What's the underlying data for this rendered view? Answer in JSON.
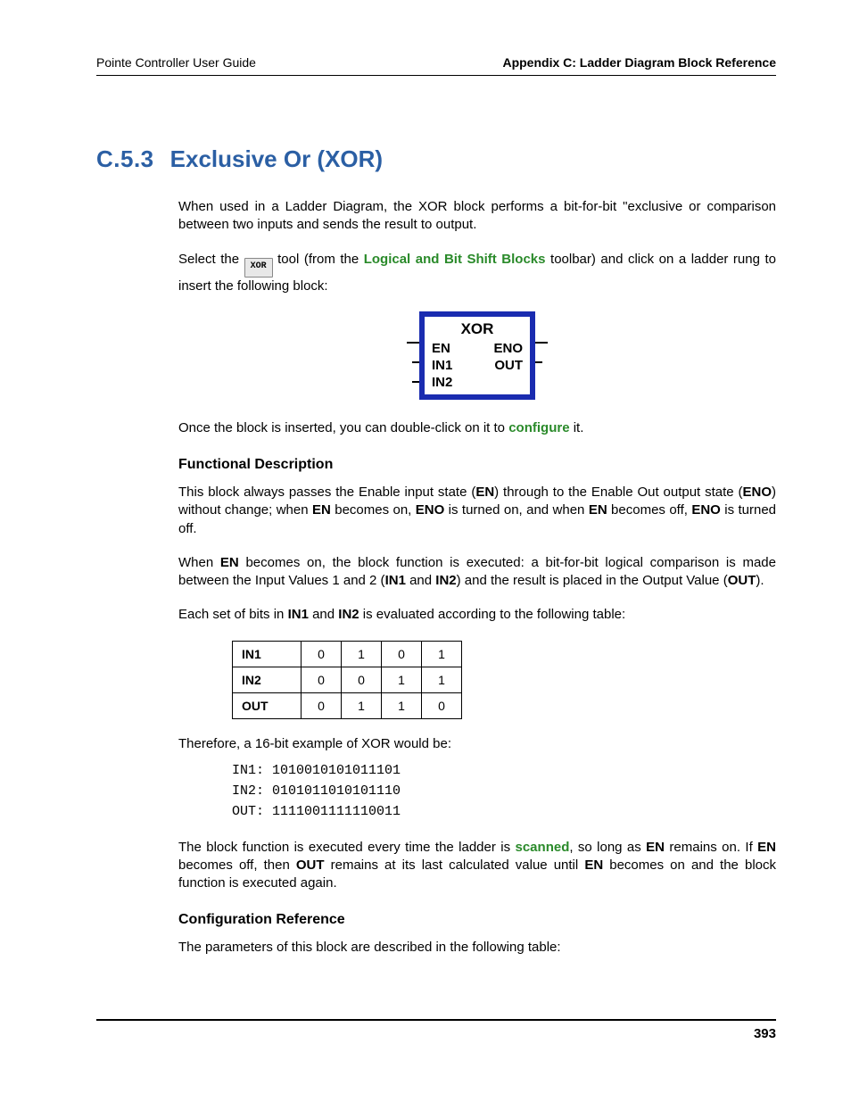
{
  "header": {
    "left": "Pointe Controller User Guide",
    "right": "Appendix C: Ladder Diagram Block Reference"
  },
  "section": {
    "number": "C.5.3",
    "title": "Exclusive Or (XOR)"
  },
  "intro_para": "When used in a Ladder Diagram, the XOR block performs a bit-for-bit \"exclusive or comparison between two inputs and sends the result to output.",
  "select_para": {
    "pre": "Select the ",
    "btn": "XOR",
    "mid": " tool (from the ",
    "link": "Logical and Bit Shift Blocks",
    "post": " toolbar) and click on a ladder rung to insert the following block:"
  },
  "block": {
    "title": "XOR",
    "rows": [
      [
        "EN",
        "ENO"
      ],
      [
        "IN1",
        "OUT"
      ],
      [
        "IN2",
        ""
      ]
    ]
  },
  "after_block": {
    "pre": "Once the block is inserted, you can double-click on it to ",
    "link": "configure",
    "post": " it."
  },
  "subhead_functional": "Functional Description",
  "func_para1": {
    "t1": "This block always passes the Enable input state (",
    "b1": "EN",
    "t2": ") through to the Enable Out output state (",
    "b2": "ENO",
    "t3": ") without change; when ",
    "b3": "EN",
    "t4": " becomes on, ",
    "b4": "ENO",
    "t5": " is turned on, and when ",
    "b5": "EN",
    "t6": " becomes off, ",
    "b6": "ENO",
    "t7": " is turned off."
  },
  "func_para2": {
    "t1": "When ",
    "b1": "EN",
    "t2": " becomes on, the block function is executed: a bit-for-bit logical comparison is made between the Input Values 1 and 2 (",
    "b2": "IN1",
    "t3": " and ",
    "b3": "IN2",
    "t4": ") and the result is placed in the Output Value (",
    "b4": "OUT",
    "t5": ")."
  },
  "func_para3": {
    "t1": "Each set of bits in ",
    "b1": "IN1",
    "t2": " and ",
    "b2": "IN2",
    "t3": " is evaluated according to the following table:"
  },
  "truth_table": {
    "rows": [
      {
        "head": "IN1",
        "cells": [
          "0",
          "1",
          "0",
          "1"
        ]
      },
      {
        "head": "IN2",
        "cells": [
          "0",
          "0",
          "1",
          "1"
        ]
      },
      {
        "head": "OUT",
        "cells": [
          "0",
          "1",
          "1",
          "0"
        ]
      }
    ]
  },
  "example_intro": "Therefore, a 16-bit example of XOR would be:",
  "example_code": "IN1: 1010010101011101\nIN2: 0101011010101110\nOUT: 1111001111110011",
  "scan_para": {
    "t1": "The block function is executed every time the ladder is ",
    "link": "scanned",
    "t2": ", so long as ",
    "b1": "EN",
    "t3": " remains on. If ",
    "b2": "EN",
    "t4": " becomes off, then ",
    "b3": "OUT",
    "t5": " remains at its last calculated value until ",
    "b4": "EN",
    "t6": " becomes on and the block function is executed again."
  },
  "subhead_config": "Configuration Reference",
  "config_para": "The parameters of this block are described in the following table:",
  "page_number": "393"
}
